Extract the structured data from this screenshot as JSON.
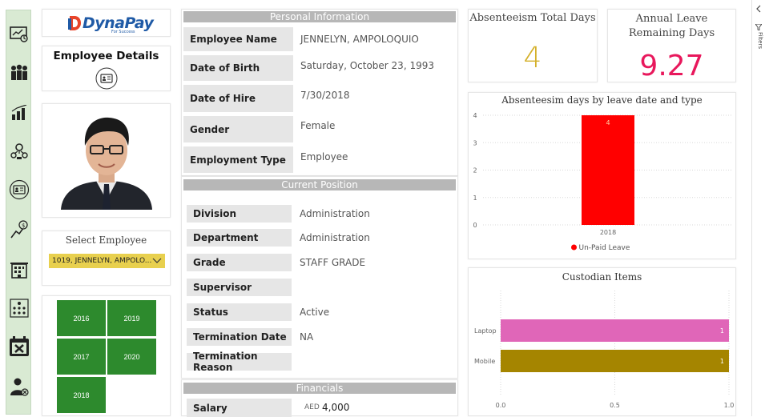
{
  "nav": {
    "icons": [
      "dashboard-icon",
      "team-icon",
      "bar-chart-icon",
      "people-network-icon",
      "id-card-icon",
      "salary-growth-icon",
      "office-building-icon",
      "org-chart-icon",
      "calendar-cancel-icon",
      "employee-exit-icon"
    ]
  },
  "logo": {
    "brand": "DynaPay",
    "tagline": "For Success"
  },
  "employee_details": {
    "title": "Employee Details"
  },
  "select_employee": {
    "label": "Select Employee",
    "value": "1019, JENNELYN, AMPOLO..."
  },
  "years": [
    "2016",
    "2019",
    "2017",
    "2020",
    "2018"
  ],
  "personal": {
    "header": "Personal Information",
    "rows": [
      {
        "label": "Employee Name",
        "value": "JENNELYN, AMPOLOQUIO"
      },
      {
        "label": "Date of Birth",
        "value": "Saturday, October 23, 1993"
      },
      {
        "label": "Date of Hire",
        "value": "7/30/2018"
      },
      {
        "label": "Gender",
        "value": "Female"
      },
      {
        "label": "Employment Type",
        "value": "Employee"
      }
    ]
  },
  "position": {
    "header": "Current Position",
    "rows": [
      {
        "label": "Division",
        "value": "Administration"
      },
      {
        "label": "Department",
        "value": "Administration"
      },
      {
        "label": "Grade",
        "value": "STAFF GRADE"
      },
      {
        "label": "Supervisor",
        "value": ""
      },
      {
        "label": "Status",
        "value": "Active"
      },
      {
        "label": "Termination Date",
        "value": "NA"
      },
      {
        "label": "Termination Reason",
        "value": ""
      }
    ]
  },
  "financials": {
    "header": "Financials",
    "salary_label": "Salary",
    "currency": "AED",
    "salary": "4,000"
  },
  "kpi": {
    "absenteeism_title": "Absenteeism Total Days",
    "absenteeism_value": "4",
    "annual_title": "Annual Leave Remaining Days",
    "annual_value": "9.27",
    "absenteeism_color": "#d4b02a",
    "annual_color": "#e8185c"
  },
  "right_pane": {
    "filters_label": "Filters"
  },
  "chart_data": [
    {
      "type": "bar",
      "title": "Absenteesim days by leave date and type",
      "categories": [
        "2018"
      ],
      "series": [
        {
          "name": "Un-Paid Leave",
          "values": [
            4
          ],
          "color": "#ff0000"
        }
      ],
      "yticks": [
        "0",
        "1",
        "2",
        "3",
        "4"
      ],
      "ylim": [
        0,
        4
      ],
      "data_labels": [
        "4"
      ],
      "legend": "bottom"
    },
    {
      "type": "bar",
      "orientation": "horizontal",
      "title": "Custodian Items",
      "categories": [
        "Laptop",
        "Mobile"
      ],
      "values": [
        1,
        1
      ],
      "colors": [
        "#e066b8",
        "#a58500"
      ],
      "xticks": [
        "0.0",
        "0.5",
        "1.0"
      ],
      "xlim": [
        0,
        1
      ],
      "data_labels": [
        "1",
        "1"
      ]
    }
  ]
}
